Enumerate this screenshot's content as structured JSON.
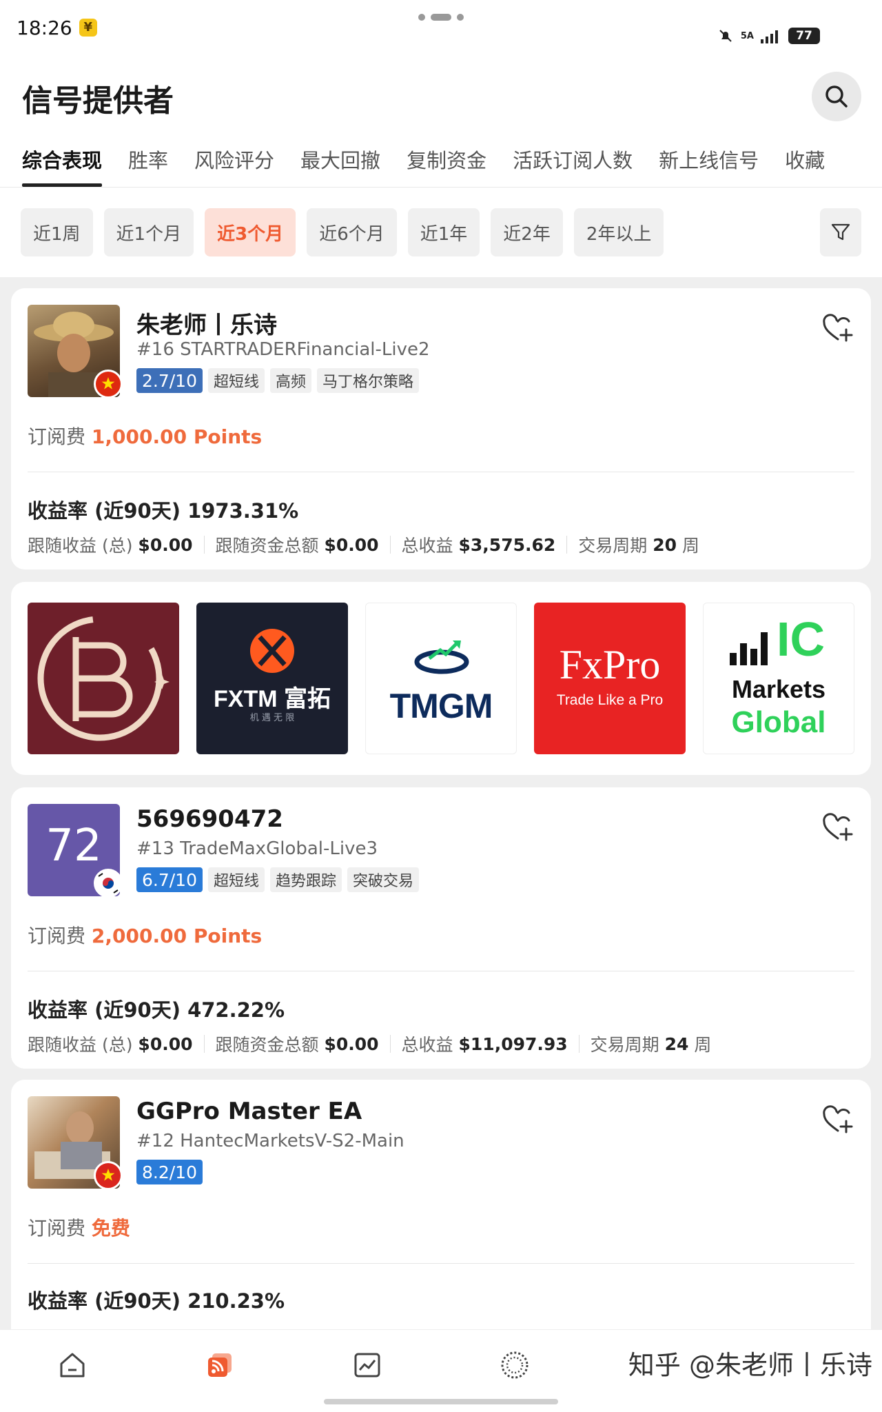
{
  "status_bar": {
    "time": "18:26",
    "network": "5A",
    "battery": "77"
  },
  "header": {
    "title": "信号提供者"
  },
  "tabs": [
    "综合表现",
    "胜率",
    "风险评分",
    "最大回撤",
    "复制资金",
    "活跃订阅人数",
    "新上线信号",
    "收藏"
  ],
  "periods": [
    "近1周",
    "近1个月",
    "近3个月",
    "近6个月",
    "近1年",
    "近2年",
    "2年以上"
  ],
  "active_period": "近3个月",
  "providers": [
    {
      "name": "朱老师丨乐诗",
      "account": "#16 STARTRADERFinancial-Live2",
      "score": "2.7/10",
      "score_color": "#3d6fb8",
      "tags": [
        "超短线",
        "高频",
        "马丁格尔策略"
      ],
      "fee_label": "订阅费",
      "fee_value": "1,000.00 Points",
      "return_label": "收益率 (近90天)",
      "return_value": "1973.31%",
      "stats": [
        {
          "label": "跟随收益 (总)",
          "value": "$0.00"
        },
        {
          "label": "跟随资金总额",
          "value": "$0.00"
        },
        {
          "label": "总收益",
          "value": "$3,575.62"
        },
        {
          "label": "交易周期",
          "value": "20",
          "unit": "周"
        }
      ]
    },
    {
      "name": "569690472",
      "account": "#13 TradeMaxGlobal-Live3",
      "avatar_text": "72",
      "score": "6.7/10",
      "score_color": "#2a7bd8",
      "tags": [
        "超短线",
        "趋势跟踪",
        "突破交易"
      ],
      "fee_label": "订阅费",
      "fee_value": "2,000.00 Points",
      "return_label": "收益率 (近90天)",
      "return_value": "472.22%",
      "stats": [
        {
          "label": "跟随收益 (总)",
          "value": "$0.00"
        },
        {
          "label": "跟随资金总额",
          "value": "$0.00"
        },
        {
          "label": "总收益",
          "value": "$11,097.93"
        },
        {
          "label": "交易周期",
          "value": "24",
          "unit": "周"
        }
      ]
    },
    {
      "name": "GGPro Master EA",
      "account": "#12 HantecMarketsV-S2-Main",
      "score": "8.2/10",
      "score_color": "#2a7bd8",
      "tags": [],
      "fee_label": "订阅费",
      "fee_value": "免费",
      "return_label": "收益率 (近90天)",
      "return_value": "210.23%"
    }
  ],
  "brokers": [
    {
      "name": "FXTM 富拓",
      "sub": "机 遇 无 限"
    },
    {
      "name": "TMGM"
    },
    {
      "name": "FxPro",
      "sub": "Trade Like a Pro"
    },
    {
      "name": "IC",
      "line2": "Markets",
      "line3": "Global"
    }
  ],
  "watermark": "知乎 @朱老师丨乐诗"
}
